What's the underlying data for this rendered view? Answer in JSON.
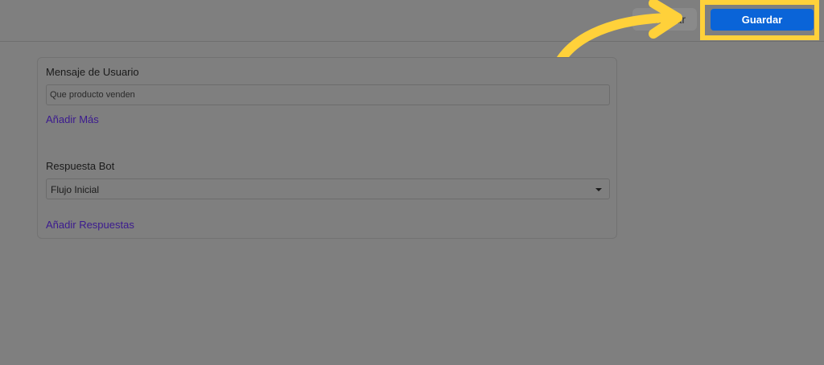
{
  "toolbar": {
    "cancel_label": "Cancelar",
    "save_label": "Guardar"
  },
  "form": {
    "user_message_label": "Mensaje de Usuario",
    "user_message_value": "Que producto venden",
    "add_more_label": "Añadir Más",
    "bot_response_label": "Respuesta Bot",
    "bot_response_selected": "Flujo Inicial",
    "add_responses_label": "Añadir Respuestas"
  },
  "colors": {
    "overlay": "#7f7f7f",
    "highlight": "#ffd13a",
    "primary": "#0a64d8",
    "link": "#3b1a8f"
  }
}
